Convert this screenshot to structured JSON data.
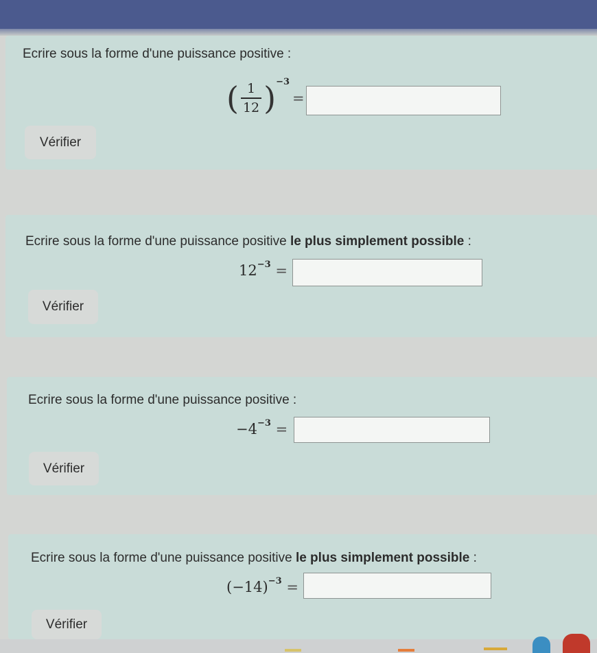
{
  "exercises": [
    {
      "prompt": "Ecrire sous la forme d'une puissance positive :",
      "prompt_bold": "",
      "prompt_end": "",
      "expr_num": "1",
      "expr_den": "12",
      "exponent": "−3",
      "equals": "=",
      "answer": "",
      "verify_label": "Vérifier"
    },
    {
      "prompt": "Ecrire sous la forme d'une puissance positive ",
      "prompt_bold": "le plus simplement possible",
      "prompt_end": " :",
      "expr_base": "12",
      "exponent": "−3",
      "equals": "=",
      "answer": "",
      "verify_label": "Vérifier"
    },
    {
      "prompt": "Ecrire sous la forme d'une puissance positive :",
      "prompt_bold": "",
      "prompt_end": "",
      "expr_base": "−4",
      "exponent": "−3",
      "equals": "=",
      "answer": "",
      "verify_label": "Vérifier"
    },
    {
      "prompt": "Ecrire sous la forme d'une puissance positive ",
      "prompt_bold": "le plus simplement possible",
      "prompt_end": " :",
      "expr_base": "(−14)",
      "exponent": "−3",
      "equals": "=",
      "answer": "",
      "verify_label": "Vérifier"
    }
  ],
  "colors": {
    "card_bg": "#c9dcd8",
    "topbar": "#4b5a8e",
    "button_bg": "#d7dad8"
  }
}
